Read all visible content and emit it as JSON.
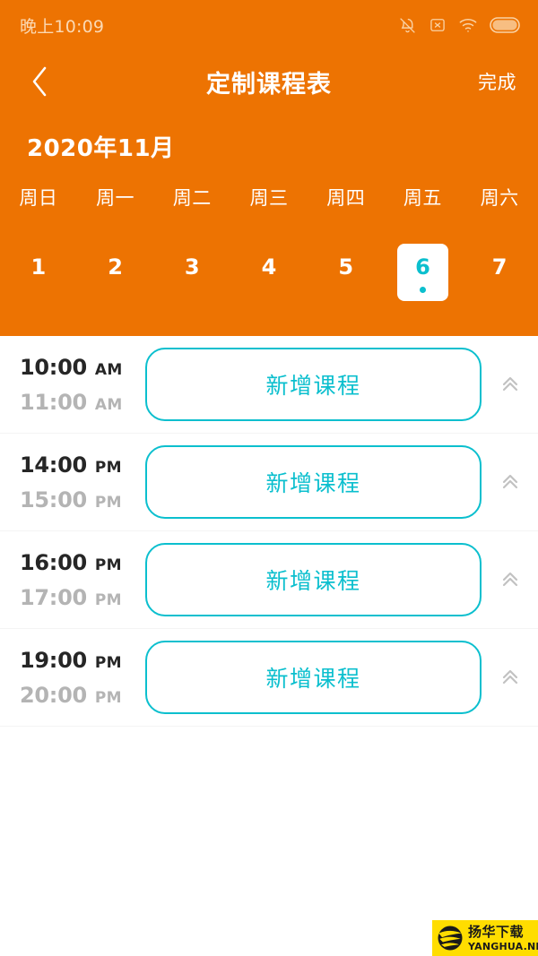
{
  "theme": {
    "accent_orange": "#ED7302",
    "accent_teal": "#0BBFCE",
    "watermark_yellow": "#FFDD00"
  },
  "status_bar": {
    "time": "晚上10:09",
    "icons": [
      "bell-muted-icon",
      "boxed-x-icon",
      "wifi-icon",
      "battery-icon"
    ]
  },
  "nav_bar": {
    "back_label": "‹",
    "title": "定制课程表",
    "action_label": "完成"
  },
  "calendar": {
    "month_label": "2020年11月",
    "weekdays": [
      "周日",
      "周一",
      "周二",
      "周三",
      "周四",
      "周五",
      "周六"
    ],
    "days": [
      {
        "num": "1",
        "selected": false
      },
      {
        "num": "2",
        "selected": false
      },
      {
        "num": "3",
        "selected": false
      },
      {
        "num": "4",
        "selected": false
      },
      {
        "num": "5",
        "selected": false
      },
      {
        "num": "6",
        "selected": true
      },
      {
        "num": "7",
        "selected": false
      }
    ],
    "selected_day": "6"
  },
  "schedule": {
    "add_label": "新增课程",
    "collapse_icon": "chevron-double-up-icon",
    "slots": [
      {
        "start_time": "10:00",
        "start_meridiem": "AM",
        "end_time": "11:00",
        "end_meridiem": "AM",
        "add_label": "新增课程"
      },
      {
        "start_time": "14:00",
        "start_meridiem": "PM",
        "end_time": "15:00",
        "end_meridiem": "PM",
        "add_label": "新增课程"
      },
      {
        "start_time": "16:00",
        "start_meridiem": "PM",
        "end_time": "17:00",
        "end_meridiem": "PM",
        "add_label": "新增课程"
      },
      {
        "start_time": "19:00",
        "start_meridiem": "PM",
        "end_time": "20:00",
        "end_meridiem": "PM",
        "add_label": "新增课程"
      }
    ]
  },
  "watermark": {
    "cn_text": "扬华下载",
    "en_text": "YANGHUA.NET"
  }
}
